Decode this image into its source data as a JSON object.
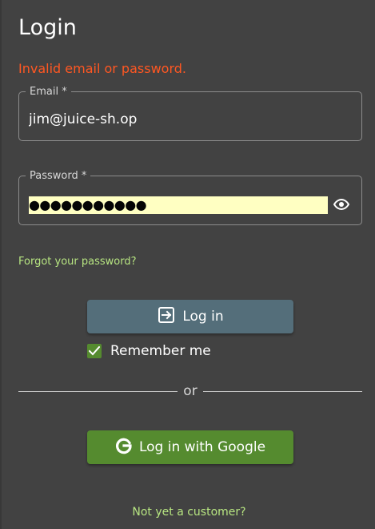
{
  "header": {
    "title": "Login"
  },
  "form": {
    "error": "Invalid email or password.",
    "email": {
      "label": "Email *",
      "value": "jim@juice-sh.op"
    },
    "password": {
      "label": "Password *",
      "masked_value": "●●●●●●●●●●●",
      "icon": "eye-icon"
    },
    "forgot_password": "Forgot your password?",
    "login_button": {
      "label": "Log in",
      "icon": "login-icon"
    },
    "remember_me": {
      "label": "Remember me",
      "checked": true
    },
    "divider": "or",
    "google_button": {
      "label": "Log in with Google",
      "icon": "google-icon"
    },
    "register_link": "Not yet a customer?"
  },
  "colors": {
    "background": "#424242",
    "error": "#ff5722",
    "accent_green": "#558b2f",
    "link_green": "#b7e581",
    "login_button": "#546e7a",
    "password_autofill": "#ffffc2"
  }
}
